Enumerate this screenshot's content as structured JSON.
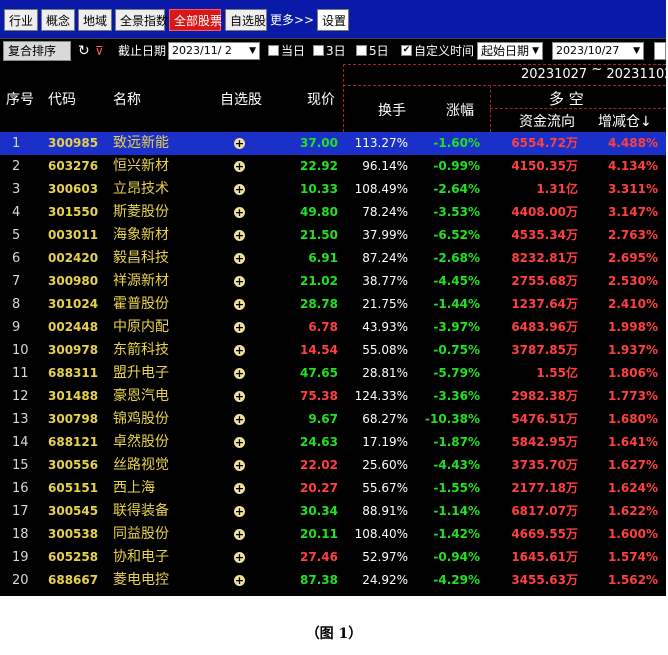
{
  "toolbar": {
    "tabs": [
      {
        "label": "行业",
        "active": false
      },
      {
        "label": "概念",
        "active": false
      },
      {
        "label": "地域",
        "active": false
      },
      {
        "label": "全景指数",
        "active": false
      },
      {
        "label": "全部股票",
        "active": true
      },
      {
        "label": "自选股",
        "active": false
      }
    ],
    "more_label": "更多>>",
    "settings_label": "设置"
  },
  "filter": {
    "reset_sort_label": "复合排序",
    "end_date_label": "截止日期",
    "end_date_value": "2023/11/ 2",
    "options": [
      {
        "label": "当日",
        "checked": false
      },
      {
        "label": "3日",
        "checked": false
      },
      {
        "label": "5日",
        "checked": false
      },
      {
        "label": "自定义时间",
        "checked": true
      }
    ],
    "start_date_select": "起始日期",
    "start_date_value": "2023/10/27"
  },
  "table": {
    "date_range": {
      "from": "20231027",
      "sep": "~",
      "to": "20231102"
    },
    "columns": {
      "no": "序号",
      "code": "代码",
      "name": "名称",
      "watchlist": "自选股",
      "price": "现价",
      "turnover": "换手",
      "change": "涨幅",
      "long_short": "多  空",
      "fund_flow": "资金流向",
      "increase": "增减仓",
      "sort_icon": "arrow-down-icon"
    },
    "rows": [
      {
        "no": "1",
        "code": "300985",
        "name": "致远新能",
        "price": "37.00",
        "turnover": "113.27%",
        "change": "-1.60%",
        "flow": "6554.72万",
        "inc": "4.488%",
        "selected": true
      },
      {
        "no": "2",
        "code": "603276",
        "name": "恒兴新材",
        "price": "22.92",
        "turnover": "96.14%",
        "change": "-0.99%",
        "flow": "4150.35万",
        "inc": "4.134%"
      },
      {
        "no": "3",
        "code": "300603",
        "name": "立昂技术",
        "price": "10.33",
        "turnover": "108.49%",
        "change": "-2.64%",
        "flow": "1.31亿",
        "inc": "3.311%"
      },
      {
        "no": "4",
        "code": "301550",
        "name": "斯菱股份",
        "price": "49.80",
        "turnover": "78.24%",
        "change": "-3.53%",
        "flow": "4408.00万",
        "inc": "3.147%"
      },
      {
        "no": "5",
        "code": "003011",
        "name": "海象新材",
        "price": "21.50",
        "turnover": "37.99%",
        "change": "-6.52%",
        "flow": "4535.34万",
        "inc": "2.763%"
      },
      {
        "no": "6",
        "code": "002420",
        "name": "毅昌科技",
        "price": "6.91",
        "turnover": "87.24%",
        "change": "-2.68%",
        "flow": "8232.81万",
        "inc": "2.695%"
      },
      {
        "no": "7",
        "code": "300980",
        "name": "祥源新材",
        "price": "21.02",
        "turnover": "38.77%",
        "change": "-4.45%",
        "flow": "2755.68万",
        "inc": "2.530%"
      },
      {
        "no": "8",
        "code": "301024",
        "name": "霍普股份",
        "price": "28.78",
        "turnover": "21.75%",
        "change": "-1.44%",
        "flow": "1237.64万",
        "inc": "2.410%"
      },
      {
        "no": "9",
        "code": "002448",
        "name": "中原内配",
        "price": "6.78",
        "priceUp": true,
        "turnover": "43.93%",
        "change": "-3.97%",
        "flow": "6483.96万",
        "inc": "1.998%"
      },
      {
        "no": "10",
        "code": "300978",
        "name": "东箭科技",
        "price": "14.54",
        "priceUp": true,
        "turnover": "55.08%",
        "change": "-0.75%",
        "flow": "3787.85万",
        "inc": "1.937%"
      },
      {
        "no": "11",
        "code": "688311",
        "name": "盟升电子",
        "price": "47.65",
        "turnover": "28.81%",
        "change": "-5.79%",
        "flow": "1.55亿",
        "inc": "1.806%"
      },
      {
        "no": "12",
        "code": "301488",
        "name": "豪恩汽电",
        "price": "75.38",
        "priceUp": true,
        "turnover": "124.33%",
        "change": "-3.36%",
        "flow": "2982.38万",
        "inc": "1.773%"
      },
      {
        "no": "13",
        "code": "300798",
        "name": "锦鸡股份",
        "price": "9.67",
        "turnover": "68.27%",
        "change": "-10.38%",
        "flow": "5476.51万",
        "inc": "1.680%"
      },
      {
        "no": "14",
        "code": "688121",
        "name": "卓然股份",
        "price": "24.63",
        "turnover": "17.19%",
        "change": "-1.87%",
        "flow": "5842.95万",
        "inc": "1.641%"
      },
      {
        "no": "15",
        "code": "300556",
        "name": "丝路视觉",
        "price": "22.02",
        "priceUp": true,
        "turnover": "25.60%",
        "change": "-4.43%",
        "flow": "3735.70万",
        "inc": "1.627%"
      },
      {
        "no": "16",
        "code": "605151",
        "name": "西上海",
        "price": "20.27",
        "priceUp": true,
        "turnover": "55.67%",
        "change": "-1.55%",
        "flow": "2177.18万",
        "inc": "1.624%"
      },
      {
        "no": "17",
        "code": "300545",
        "name": "联得装备",
        "price": "30.34",
        "turnover": "88.91%",
        "change": "-1.14%",
        "flow": "6817.07万",
        "inc": "1.622%"
      },
      {
        "no": "18",
        "code": "300538",
        "name": "同益股份",
        "price": "20.11",
        "turnover": "108.40%",
        "change": "-1.42%",
        "flow": "4669.55万",
        "inc": "1.600%"
      },
      {
        "no": "19",
        "code": "605258",
        "name": "协和电子",
        "price": "27.46",
        "priceUp": true,
        "turnover": "52.97%",
        "change": "-0.94%",
        "flow": "1645.61万",
        "inc": "1.574%"
      },
      {
        "no": "20",
        "code": "688667",
        "name": "菱电电控",
        "price": "87.38",
        "turnover": "24.92%",
        "change": "-4.29%",
        "flow": "3455.63万",
        "inc": "1.562%"
      }
    ]
  },
  "caption": "（图 1）"
}
